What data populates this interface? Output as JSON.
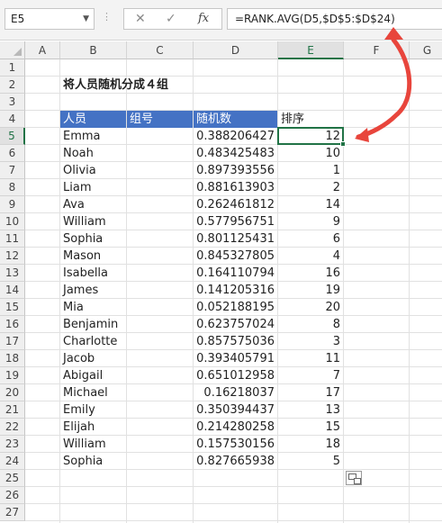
{
  "formula_bar": {
    "name_box": "E5",
    "cancel_icon": "✕",
    "enter_icon": "✓",
    "fx_label": "fx",
    "formula": "=RANK.AVG(D5,$D$5:$D$24)"
  },
  "columns": [
    "A",
    "B",
    "C",
    "D",
    "E",
    "F",
    "G"
  ],
  "rows": [
    "1",
    "2",
    "3",
    "4",
    "5",
    "6",
    "7",
    "8",
    "9",
    "10",
    "11",
    "12",
    "13",
    "14",
    "15",
    "16",
    "17",
    "18",
    "19",
    "20",
    "21",
    "22",
    "23",
    "24",
    "25",
    "26",
    "27"
  ],
  "sheet": {
    "title": "将人员随机分成４组",
    "headers": {
      "person": "人员",
      "group": "组号",
      "random": "随机数",
      "rank": "排序"
    },
    "data": [
      {
        "name": "Emma",
        "random": "0.388206427",
        "rank": "12"
      },
      {
        "name": "Noah",
        "random": "0.483425483",
        "rank": "10"
      },
      {
        "name": "Olivia",
        "random": "0.897393556",
        "rank": "1"
      },
      {
        "name": "Liam",
        "random": "0.881613903",
        "rank": "2"
      },
      {
        "name": "Ava",
        "random": "0.262461812",
        "rank": "14"
      },
      {
        "name": "William",
        "random": "0.577956751",
        "rank": "9"
      },
      {
        "name": "Sophia",
        "random": "0.801125431",
        "rank": "6"
      },
      {
        "name": "Mason",
        "random": "0.845327805",
        "rank": "4"
      },
      {
        "name": "Isabella",
        "random": "0.164110794",
        "rank": "16"
      },
      {
        "name": "James",
        "random": "0.141205316",
        "rank": "19"
      },
      {
        "name": "Mia",
        "random": "0.052188195",
        "rank": "20"
      },
      {
        "name": "Benjamin",
        "random": "0.623757024",
        "rank": "8"
      },
      {
        "name": "Charlotte",
        "random": "0.857575036",
        "rank": "3"
      },
      {
        "name": "Jacob",
        "random": "0.393405791",
        "rank": "11"
      },
      {
        "name": "Abigail",
        "random": "0.651012958",
        "rank": "7"
      },
      {
        "name": "Michael",
        "random": "0.16218037",
        "rank": "17"
      },
      {
        "name": "Emily",
        "random": "0.350394437",
        "rank": "13"
      },
      {
        "name": "Elijah",
        "random": "0.214280258",
        "rank": "15"
      },
      {
        "name": "William",
        "random": "0.157530156",
        "rank": "18"
      },
      {
        "name": "Sophia",
        "random": "0.827665938",
        "rank": "5"
      }
    ]
  },
  "colors": {
    "header_fill": "#4472c4",
    "selection": "#217346",
    "arrow": "#e8453c"
  },
  "icons": {
    "paste_options": "paste-options-icon",
    "annotation": "red-curved-arrow"
  }
}
